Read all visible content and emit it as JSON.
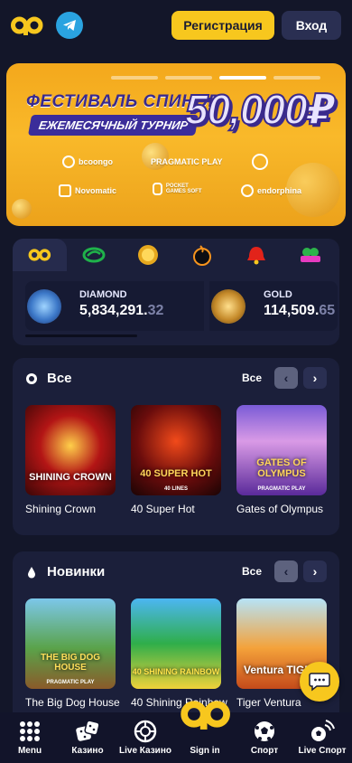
{
  "header": {
    "logo": "go-logo",
    "telegram_icon": "telegram-icon",
    "register_label": "Регистрация",
    "login_label": "Вход"
  },
  "banner": {
    "title": "ФЕСТИВАЛЬ СПИНОВ",
    "subtitle": "ЕЖЕМЕСЯЧНЫЙ ТУРНИР",
    "amount": "50,000₽",
    "providers": [
      "bcoongo",
      "PRAGMATIC PLAY",
      "Novomatic",
      "POCKET GAMES SOFT",
      "endorphina"
    ],
    "slides_total": 4,
    "active_slide": 2
  },
  "jackpots": {
    "tabs": [
      "go-logo",
      "endorphina-logo",
      "golden-coins-logo",
      "pragmatic-play-logo",
      "bell-link-logo",
      "clover-chance-logo"
    ],
    "active_tab": 0,
    "items": [
      {
        "name": "DIAMOND",
        "value_main": "5,834,291.",
        "value_dec": "32"
      },
      {
        "name": "GOLD",
        "value_main": "114,509.",
        "value_dec": "65"
      }
    ]
  },
  "sections": [
    {
      "title": "Все",
      "all_label": "Все",
      "icon": "chip-icon",
      "games": [
        {
          "name": "Shining Crown",
          "tag": "SHINING CROWN"
        },
        {
          "name": "40 Super Hot",
          "tag": "40 SUPER HOT",
          "sub": "40 LINES"
        },
        {
          "name": "Gates of Olympus",
          "tag": "GATES OF OLYMPUS",
          "sub": "PRAGMATIC PLAY"
        }
      ]
    },
    {
      "title": "Новинки",
      "all_label": "Все",
      "icon": "drop-icon",
      "games": [
        {
          "name": "The Big Dog House",
          "tag": "THE BIG DOG HOUSE",
          "sub": "PRAGMATIC PLAY"
        },
        {
          "name": "40 Shining Rainbow",
          "tag": "40 SHINING RAINBOW"
        },
        {
          "name": "Tiger Ventura",
          "tag": "Ventura TIGER"
        }
      ]
    }
  ],
  "nav": [
    {
      "label": "Menu",
      "icon": "menu-grid-icon"
    },
    {
      "label": "Казино",
      "icon": "dice-icon"
    },
    {
      "label": "Live Казино",
      "icon": "roulette-icon"
    },
    {
      "label": "Sign in",
      "icon": "go-logo"
    },
    {
      "label": "Спорт",
      "icon": "soccer-ball-icon"
    },
    {
      "label": "Live Спорт",
      "icon": "live-signal-icon"
    }
  ],
  "colors": {
    "accent": "#f7c71e",
    "background": "#131629",
    "panel": "#1b1f3a",
    "telegram": "#2aa3e0"
  }
}
